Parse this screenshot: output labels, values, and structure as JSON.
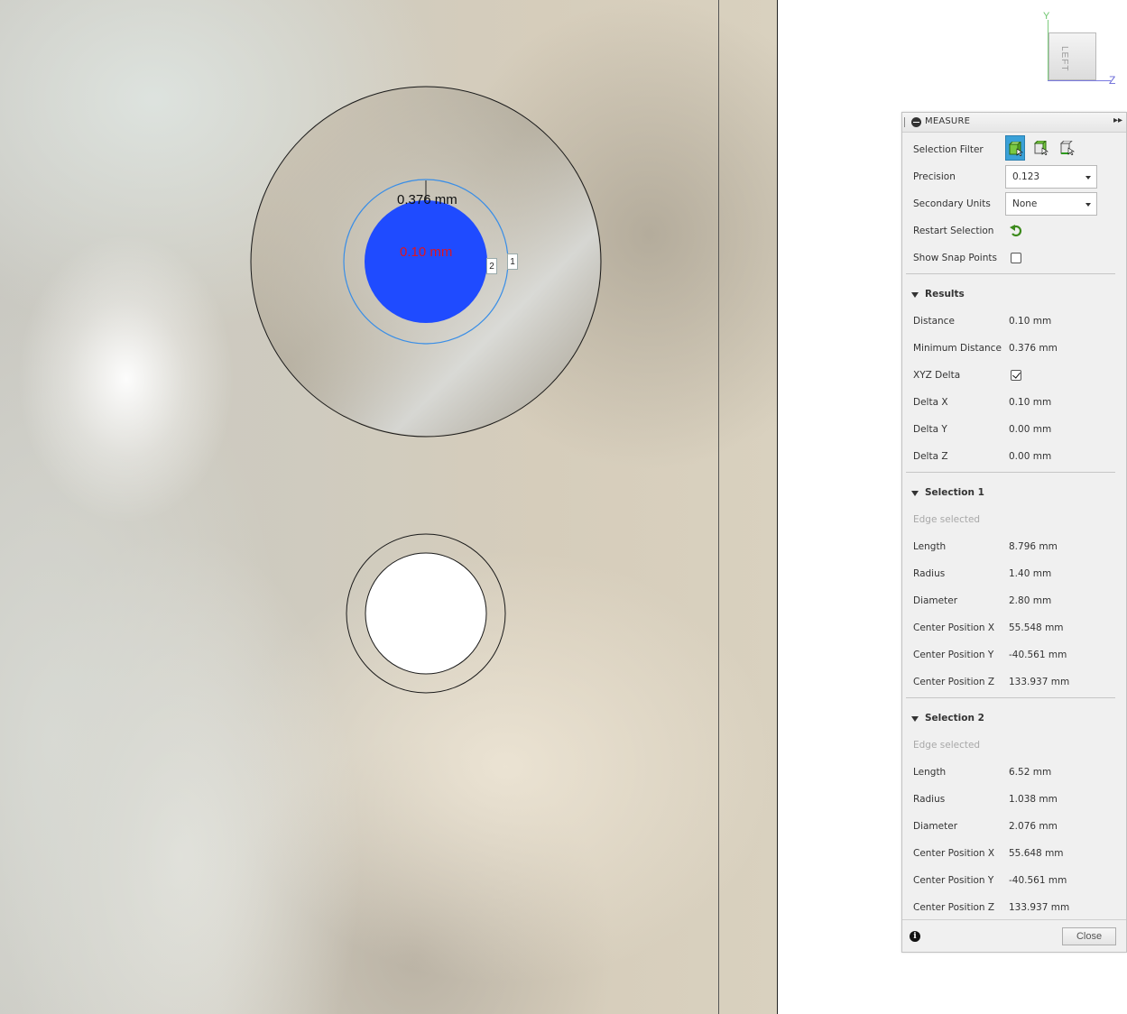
{
  "viewport": {
    "dim_min_distance": "0.376 mm",
    "dim_distance": "0.10 mm",
    "selection_tag_1": "1",
    "selection_tag_2": "2"
  },
  "viewcube": {
    "face_label": "LEFT",
    "axis_y": "Y",
    "axis_z": "Z"
  },
  "measure": {
    "title": "MEASURE",
    "selection_filter_label": "Selection Filter",
    "precision_label": "Precision",
    "precision_value": "0.123",
    "secondary_units_label": "Secondary Units",
    "secondary_units_value": "None",
    "restart_selection_label": "Restart Selection",
    "show_snap_points_label": "Show Snap Points",
    "show_snap_points_checked": false,
    "results": {
      "title": "Results",
      "rows": [
        {
          "label": "Distance",
          "value": "0.10 mm"
        },
        {
          "label": "Minimum Distance",
          "value": "0.376 mm"
        },
        {
          "label": "XYZ Delta",
          "value": ""
        },
        {
          "label": "Delta X",
          "value": "0.10 mm"
        },
        {
          "label": "Delta Y",
          "value": "0.00 mm"
        },
        {
          "label": "Delta Z",
          "value": "0.00 mm"
        }
      ],
      "xyz_delta_checked": true
    },
    "selection1": {
      "title": "Selection 1",
      "status": "Edge selected",
      "rows": [
        {
          "label": "Length",
          "value": "8.796 mm"
        },
        {
          "label": "Radius",
          "value": "1.40 mm"
        },
        {
          "label": "Diameter",
          "value": "2.80 mm"
        },
        {
          "label": "Center Position X",
          "value": "55.548 mm"
        },
        {
          "label": "Center Position Y",
          "value": "-40.561 mm"
        },
        {
          "label": "Center Position Z",
          "value": "133.937 mm"
        }
      ]
    },
    "selection2": {
      "title": "Selection 2",
      "status": "Edge selected",
      "rows": [
        {
          "label": "Length",
          "value": "6.52 mm"
        },
        {
          "label": "Radius",
          "value": "1.038 mm"
        },
        {
          "label": "Diameter",
          "value": "2.076 mm"
        },
        {
          "label": "Center Position X",
          "value": "55.648 mm"
        },
        {
          "label": "Center Position Y",
          "value": "-40.561 mm"
        },
        {
          "label": "Center Position Z",
          "value": "133.937 mm"
        }
      ]
    },
    "close_label": "Close",
    "info_glyph": "i"
  },
  "colors": {
    "selection_fill": "#1f4bff",
    "selection_outline": "#3a8ee6",
    "dimension_red": "#e0141e",
    "active_filter": "#3aa1d8"
  }
}
